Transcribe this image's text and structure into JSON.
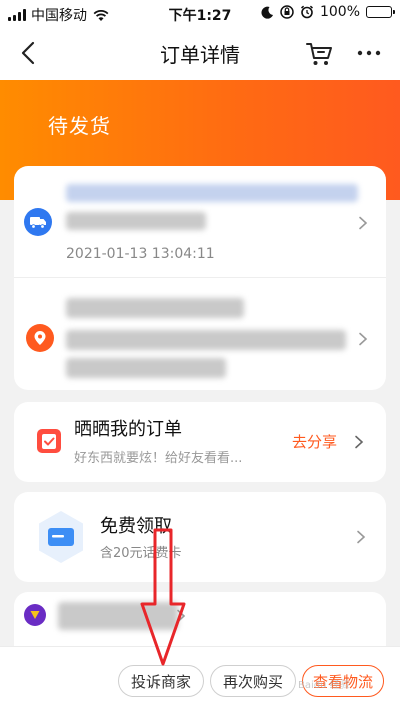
{
  "status_bar": {
    "carrier": "中国移动",
    "time": "下午1:27",
    "battery": "100%",
    "battery_level": 1.0
  },
  "nav": {
    "title": "订单详情",
    "back_icon": "chevron-left-icon",
    "cart_icon": "cart-icon",
    "more_icon": "more-icon"
  },
  "order": {
    "status": "待发货"
  },
  "logistics": {
    "time": "2021-01-13 13:04:11",
    "icon": "truck-icon"
  },
  "address": {
    "icon": "location-pin-icon"
  },
  "share": {
    "title": "晒晒我的订单",
    "subtitle": "好东西就要炫！给好友看看...",
    "cta": "去分享"
  },
  "free_gift": {
    "title": "免费领取",
    "subtitle": "含20元话费卡"
  },
  "bottom_bar": {
    "complain": "投诉商家",
    "rebuy": "再次购买",
    "logistics": "查看物流"
  },
  "colors": {
    "accent": "#ff5a1f",
    "header_start": "#ff8c00",
    "logistics_blue": "#2f78f0",
    "annotation": "#e8262a"
  }
}
